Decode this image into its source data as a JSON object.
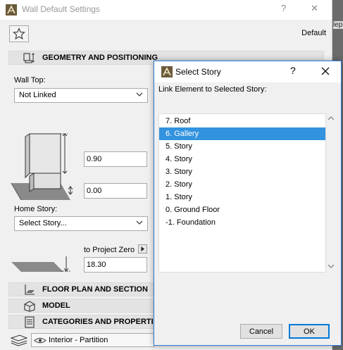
{
  "main_window": {
    "title": "Wall Default Settings",
    "title_help": "?",
    "title_close": "✕",
    "default_label": "Default",
    "sections": {
      "geometry": "GEOMETRY AND POSITIONING",
      "floor_plan": "FLOOR PLAN AND SECTION",
      "model": "MODEL",
      "categories": "CATEGORIES AND PROPERTIES"
    },
    "wall_top_label": "Wall Top:",
    "wall_top_value": "Not Linked",
    "height_value": "0.90",
    "offset_value": "0.00",
    "home_story_label": "Home Story:",
    "home_story_value": "Select Story...",
    "to_project_zero_label": "to Project Zero",
    "project_zero_value": "18.30",
    "layer_value": "Interior - Partition",
    "edge_text": "lep"
  },
  "dialog": {
    "title": "Select Story",
    "help": "?",
    "prompt": "Link Element to Selected Story:",
    "stories": [
      "7. Roof",
      "6. Gallery",
      "5. Story",
      "4. Story",
      "3. Story",
      "2. Story",
      "1. Story",
      "0. Ground Floor",
      "-1. Foundation"
    ],
    "selected_index": 1,
    "cancel_label": "Cancel",
    "ok_label": "OK"
  },
  "colors": {
    "selection": "#3393df",
    "dialog_border": "#2b79d7",
    "ok_border": "#0078d7"
  },
  "icons": {
    "favorites": "star-icon",
    "geometry": "geometry-icon",
    "floor_plan": "floor-plan-icon",
    "model": "model-icon",
    "categories": "categories-icon",
    "app": "archicad-icon",
    "layer_visibility": "eye-icon"
  }
}
